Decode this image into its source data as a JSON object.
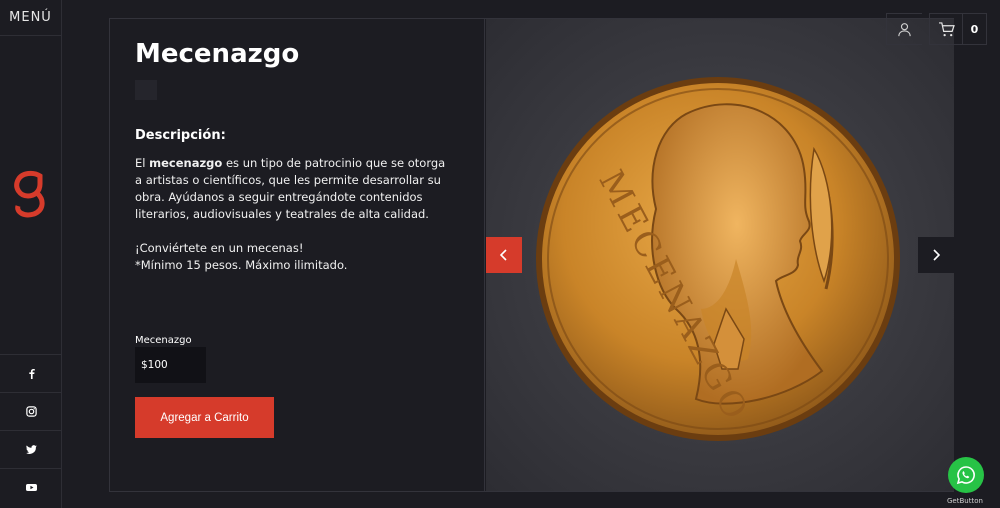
{
  "sidebar": {
    "menu_label": "MENÚ",
    "logo_icon": "g-logo-icon",
    "social": [
      "facebook-icon",
      "instagram-icon",
      "twitter-icon",
      "youtube-icon"
    ]
  },
  "product": {
    "title": "Mecenazgo",
    "description_heading": "Descripción:",
    "description_pre": "El ",
    "description_bold": "mecenazgo",
    "description_post": " es un tipo de patrocinio que se otorga a artistas o científicos, que les permite desarrollar su obra. Ayúdanos a seguir entregándote contenidos literarios, audiovisuales y teatrales de alta calidad.",
    "cta_line1": "¡Conviértete en un mecenas!",
    "cta_line2": "*Mínimo 15 pesos. Máximo ilimitado.",
    "field_label": "Mecenazgo",
    "field_value": "$100",
    "add_button": "Agregar a Carrito"
  },
  "header": {
    "cart_count": "0"
  },
  "colors": {
    "accent": "#d63b2b",
    "background": "#1c1c22",
    "whatsapp": "#27c346"
  },
  "whatsapp": {
    "brand": "GetButton"
  }
}
